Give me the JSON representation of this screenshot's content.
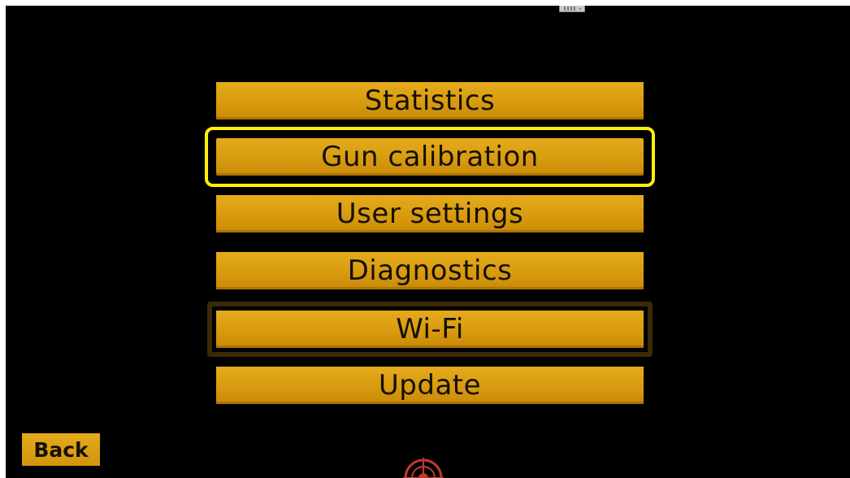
{
  "menu": {
    "items": [
      {
        "label": "Statistics"
      },
      {
        "label": "Gun calibration"
      },
      {
        "label": "User settings"
      },
      {
        "label": "Diagnostics"
      },
      {
        "label": "Wi-Fi"
      },
      {
        "label": "Update"
      }
    ],
    "highlighted_item": "Gun calibration",
    "focused_item": "Wi-Fi"
  },
  "footer": {
    "back_label": "Back",
    "center_icon": "crosshair-target-icon"
  },
  "colors": {
    "background": "#000000",
    "button": "#d89b0f",
    "button_text": "#151005",
    "highlight": "#fff200",
    "focus_border": "#3a2a06",
    "icon": "#c0392b"
  }
}
